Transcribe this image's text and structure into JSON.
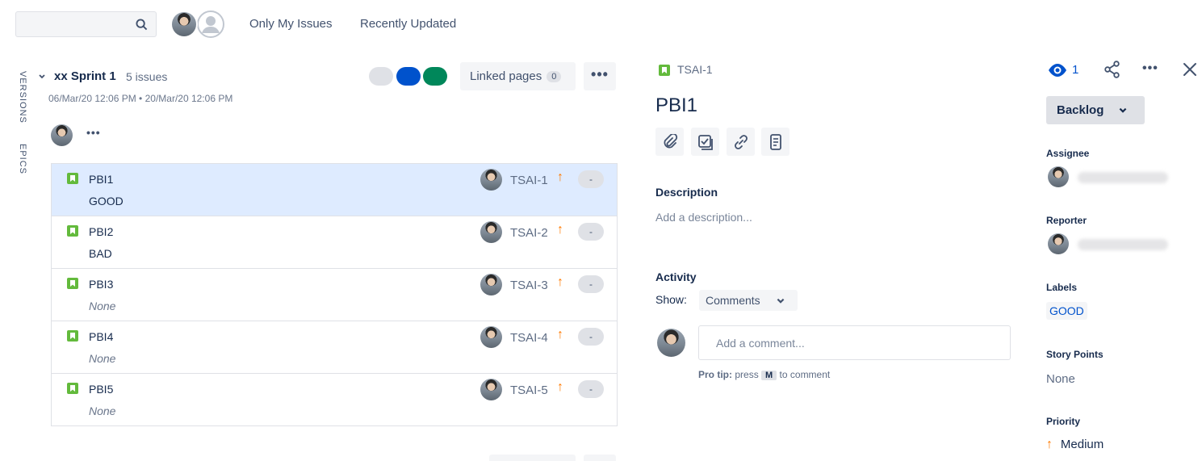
{
  "toolbar": {
    "search_placeholder": "",
    "filters": [
      "Only My Issues",
      "Recently Updated"
    ]
  },
  "side_tabs": [
    "VERSIONS",
    "EPICS"
  ],
  "sprint": {
    "name": "xx Sprint 1",
    "count": "5 issues",
    "dates": "06/Mar/20 12:06 PM  •  20/Mar/20 12:06 PM",
    "status_colors": [
      "#dfe1e6",
      "#0052cc",
      "#00875a"
    ],
    "linked_pages_label": "Linked pages",
    "linked_pages_count": "0",
    "more": "•••"
  },
  "issues": [
    {
      "summary": "PBI1",
      "epic": "GOOD",
      "key": "TSAI-1",
      "priority_icon": "↑",
      "estimate": "-",
      "selected": true
    },
    {
      "summary": "PBI2",
      "epic": "BAD",
      "key": "TSAI-2",
      "priority_icon": "↑",
      "estimate": "-"
    },
    {
      "summary": "PBI3",
      "epic": "None",
      "key": "TSAI-3",
      "priority_icon": "↑",
      "estimate": "-"
    },
    {
      "summary": "PBI4",
      "epic": "None",
      "key": "TSAI-4",
      "priority_icon": "↑",
      "estimate": "-"
    },
    {
      "summary": "PBI5",
      "epic": "None",
      "key": "TSAI-5",
      "priority_icon": "↑",
      "estimate": "-"
    }
  ],
  "detail": {
    "key": "TSAI-1",
    "title": "PBI1",
    "description_label": "Description",
    "description_placeholder": "Add a description...",
    "activity_label": "Activity",
    "show_label": "Show:",
    "show_value": "Comments",
    "comment_placeholder": "Add a comment...",
    "pro_tip_bold": "Pro tip:",
    "pro_tip_pre": "press",
    "pro_tip_key": "M",
    "pro_tip_post": "to comment"
  },
  "side": {
    "watchers": "1",
    "status": "Backlog",
    "assignee_label": "Assignee",
    "reporter_label": "Reporter",
    "labels_label": "Labels",
    "label_value": "GOOD",
    "story_points_label": "Story Points",
    "story_points_value": "None",
    "priority_label": "Priority",
    "priority_value": "Medium",
    "priority_color": "#ff7a00"
  },
  "icons": [
    "search-icon",
    "chevron-down-icon",
    "story-icon",
    "priority-arrow-icon",
    "paperclip-icon",
    "checklist-icon",
    "link-icon",
    "page-icon",
    "eye-icon",
    "share-icon",
    "more-icon",
    "close-icon"
  ]
}
